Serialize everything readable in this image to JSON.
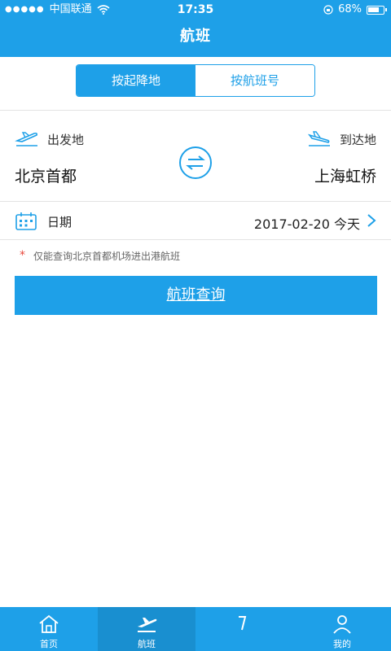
{
  "status_bar": {
    "carrier": "中国联通",
    "time": "17:35",
    "battery": "68%"
  },
  "header": {
    "title": "航班"
  },
  "segment": {
    "by_route": "按起降地",
    "by_number": "按航班号"
  },
  "route": {
    "departure_label": "出发地",
    "arrival_label": "到达地",
    "departure_city": "北京首都",
    "arrival_city": "上海虹桥"
  },
  "date": {
    "label": "日期",
    "value": "2017-02-20 今天"
  },
  "notice": {
    "star": "*",
    "text": "仅能查询北京首都机场进出港航班"
  },
  "search_button": "航班查询",
  "tabs": [
    {
      "label": "首页",
      "icon": "home-icon"
    },
    {
      "label": "航班",
      "icon": "plane-icon"
    },
    {
      "label": "",
      "icon": "service-icon"
    },
    {
      "label": "我的",
      "icon": "user-icon"
    }
  ],
  "colors": {
    "primary": "#1ea0e8",
    "notice_star": "#e8483c"
  }
}
